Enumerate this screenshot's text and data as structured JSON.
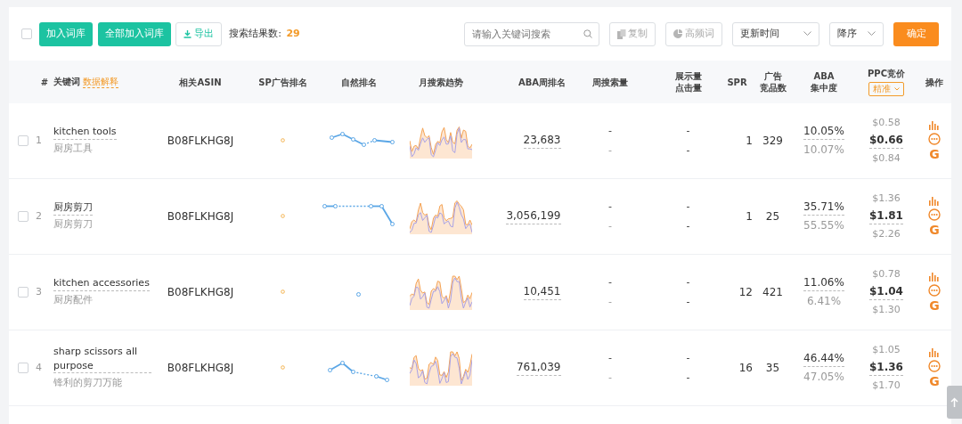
{
  "toolbar": {
    "select_all_checked": false,
    "buttons": [
      "加入词库",
      "全部加入词库"
    ],
    "export_label": "导出",
    "result_label": "搜索结果数:",
    "result_count": "29",
    "search": {
      "placeholder": "请输入关键词搜索"
    },
    "copy_label": "复制",
    "copy_disabled": true,
    "frequent_label": "高频词",
    "frequent_disabled": true,
    "sort_field": "更新时间",
    "sort_order": "降序",
    "confirm_label": "确定"
  },
  "table": {
    "columns": [
      "#",
      "关键词",
      "相关ASIN",
      "SP广告排名",
      "自然排名",
      "月搜索趋势",
      "ABA周排名",
      "周搜索量",
      [
        "展示量",
        "点击量"
      ],
      "SPR",
      [
        "广告",
        "竞品数"
      ],
      [
        "ABA",
        "集中度"
      ],
      "PPC竞价",
      "操作"
    ],
    "explain_link": "数据解释",
    "ppc_match": "精准",
    "rows": [
      {
        "checked": false,
        "index": "1",
        "keyword": "kitchen tools",
        "keyword_cn": "厨房工具",
        "asin": "B08FLKHG8J",
        "aba_rank": "23,683",
        "weekly": [
          "-",
          "-"
        ],
        "impressions": "-",
        "clicks": "-",
        "spr": "1",
        "ad_products": "329",
        "aba_conc": "10.05%",
        "aba_conc_2": "10.07%",
        "ppc_low": "$0.58",
        "ppc_mid": "$0.66",
        "ppc_high": "$0.84",
        "google": "G"
      },
      {
        "checked": false,
        "index": "2",
        "keyword": "厨房剪刀",
        "keyword_cn": "厨房剪刀",
        "asin": "B08FLKHG8J",
        "aba_rank": "3,056,199",
        "weekly": [
          "-",
          "-"
        ],
        "impressions": "-",
        "clicks": "-",
        "spr": "1",
        "ad_products": "25",
        "aba_conc": "35.71%",
        "aba_conc_2": "55.55%",
        "ppc_low": "$1.36",
        "ppc_mid": "$1.81",
        "ppc_high": "$2.26",
        "google": "G"
      },
      {
        "checked": false,
        "index": "3",
        "keyword": "kitchen accessories",
        "keyword_cn": "厨房配件",
        "asin": "B08FLKHG8J",
        "aba_rank": "10,451",
        "weekly": [
          "-",
          "-"
        ],
        "impressions": "-",
        "clicks": "-",
        "spr": "12",
        "ad_products": "421",
        "aba_conc": "11.06%",
        "aba_conc_2": "6.41%",
        "ppc_low": "$0.78",
        "ppc_mid": "$1.04",
        "ppc_high": "$1.30",
        "google": "G"
      },
      {
        "checked": false,
        "index": "4",
        "keyword": "sharp scissors all purpose",
        "keyword_cn": "锋利的剪刀万能",
        "asin": "B08FLKHG8J",
        "aba_rank": "761,039",
        "weekly": [
          "-",
          "-"
        ],
        "impressions": "-",
        "clicks": "-",
        "spr": "16",
        "ad_products": "35",
        "aba_conc": "46.44%",
        "aba_conc_2": "47.05%",
        "ppc_low": "$1.05",
        "ppc_mid": "$1.36",
        "ppc_high": "$1.70",
        "google": "G"
      }
    ]
  }
}
